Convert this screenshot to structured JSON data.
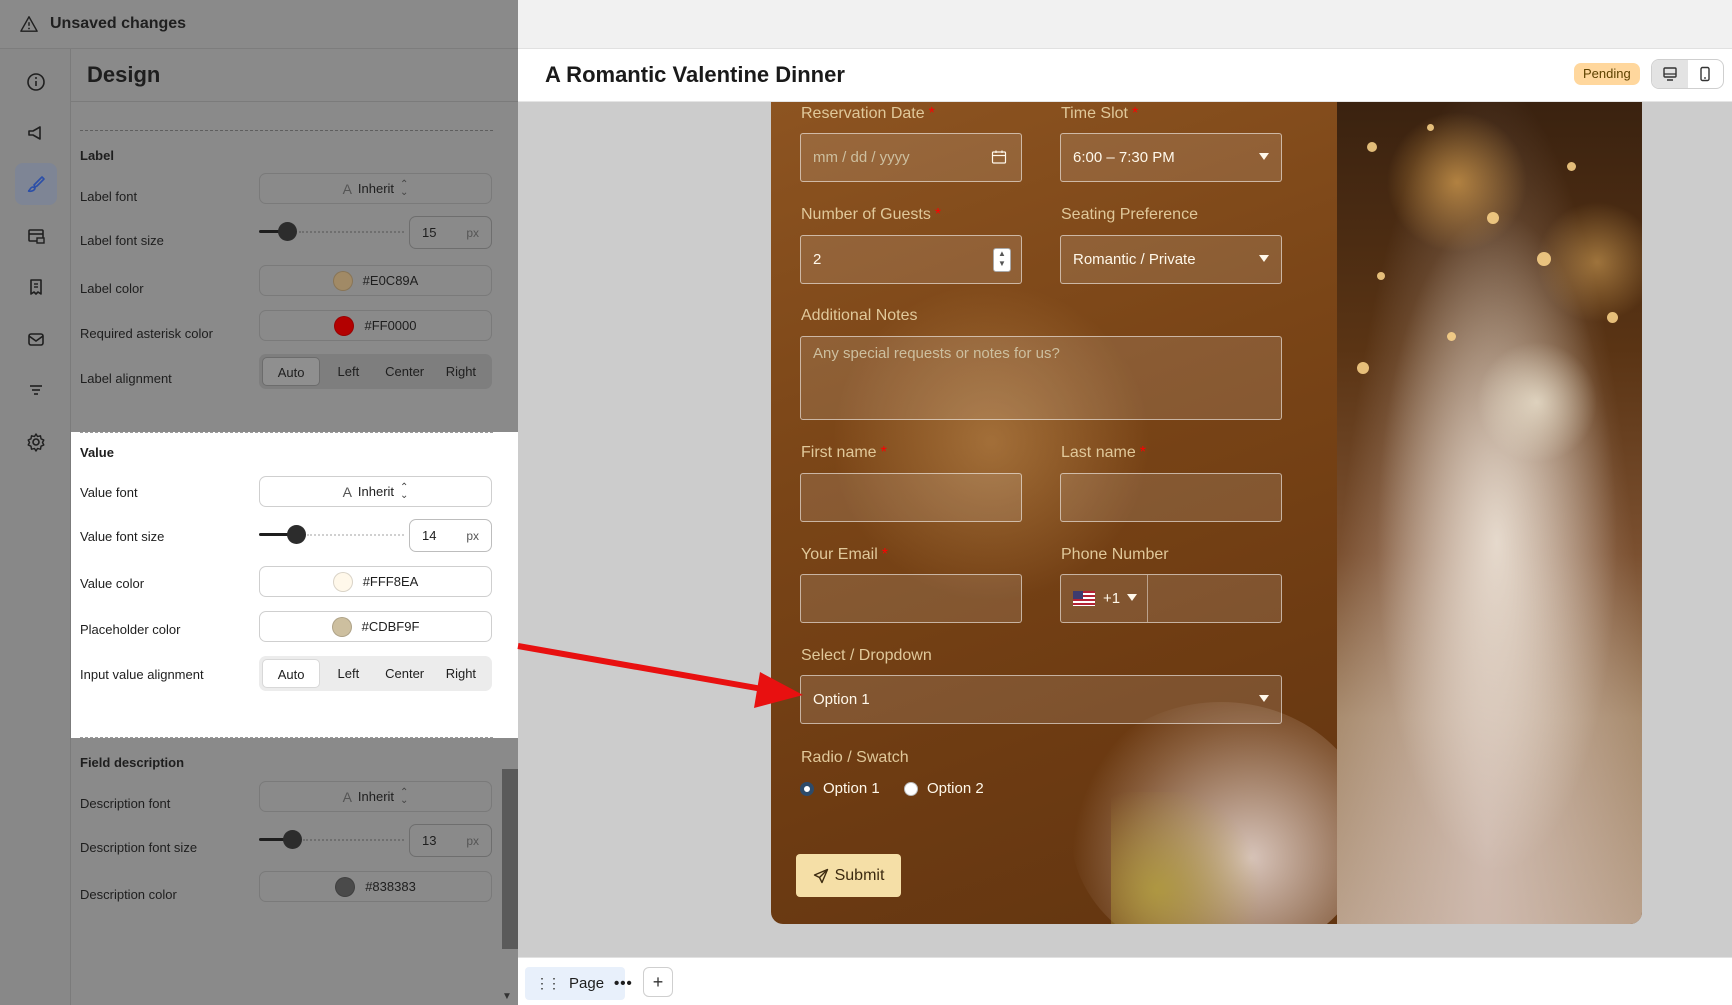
{
  "topbar": {
    "status": "Unsaved changes"
  },
  "rail": {
    "icons": [
      "info-icon",
      "megaphone-icon",
      "brush-icon",
      "layout-icon",
      "receipt-icon",
      "mail-icon",
      "list-icon",
      "settings-icon"
    ],
    "active": "brush-icon"
  },
  "panel": {
    "title": "Design",
    "label_section": {
      "title": "Label",
      "font_label": "Label font",
      "font_value": "Inherit",
      "size_label": "Label font size",
      "size_value": "15",
      "size_unit": "px",
      "color_label": "Label color",
      "color_value": "#E0C89A",
      "asterisk_label": "Required asterisk color",
      "asterisk_value": "#FF0000",
      "align_label": "Label alignment",
      "align_options": [
        "Auto",
        "Left",
        "Center",
        "Right"
      ]
    },
    "value_section": {
      "title": "Value",
      "font_label": "Value font",
      "font_value": "Inherit",
      "size_label": "Value font size",
      "size_value": "14",
      "size_unit": "px",
      "color_label": "Value color",
      "color_value": "#FFF8EA",
      "placeholder_label": "Placeholder color",
      "placeholder_value": "#CDBF9F",
      "align_label": "Input value alignment",
      "align_options": [
        "Auto",
        "Left",
        "Center",
        "Right"
      ]
    },
    "description_section": {
      "title": "Field description",
      "font_label": "Description font",
      "font_value": "Inherit",
      "size_label": "Description font size",
      "size_value": "13",
      "size_unit": "px",
      "color_label": "Description color",
      "color_value": "#838383"
    }
  },
  "preview": {
    "form_title": "A Romantic Valentine Dinner",
    "status_badge": "Pending",
    "fields": {
      "reservation_date": {
        "label": "Reservation Date",
        "placeholder": "mm / dd / yyyy"
      },
      "time_slot": {
        "label": "Time Slot",
        "value": "6:00 – 7:30 PM"
      },
      "guests": {
        "label": "Number of Guests",
        "value": "2"
      },
      "seating": {
        "label": "Seating Preference",
        "value": "Romantic / Private"
      },
      "notes": {
        "label": "Additional Notes",
        "placeholder": "Any special requests or notes for us?"
      },
      "first_name": {
        "label": "First name"
      },
      "last_name": {
        "label": "Last name"
      },
      "email": {
        "label": "Your Email"
      },
      "phone": {
        "label": "Phone Number",
        "country_code": "+1"
      },
      "dropdown": {
        "label": "Select / Dropdown",
        "value": "Option 1"
      },
      "radio": {
        "label": "Radio / Swatch",
        "options": [
          "Option 1",
          "Option 2"
        ]
      }
    },
    "submit_label": "Submit",
    "colors": {
      "label": "#E0C89A",
      "value": "#FFF8EA",
      "placeholder": "#CDBF9F",
      "asterisk": "#FF0000"
    }
  },
  "bottombar": {
    "page_tab": "Page"
  }
}
